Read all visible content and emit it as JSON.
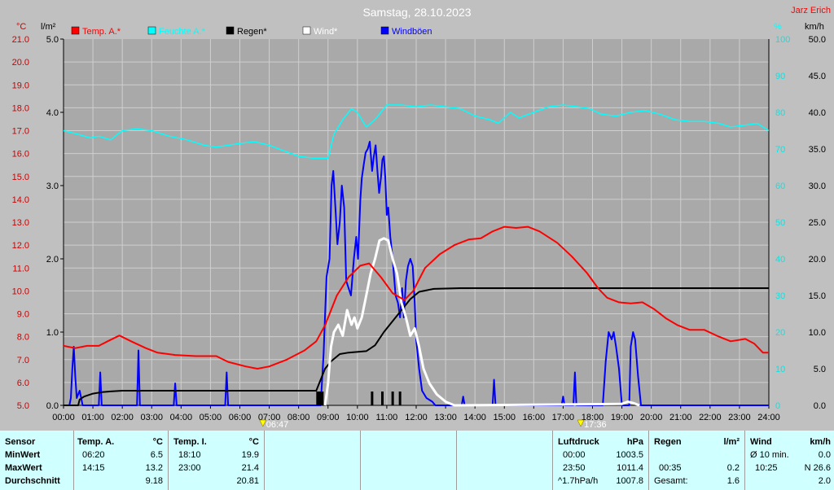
{
  "chart_data": {
    "type": "line",
    "title": "Samstag, 28.10.2023",
    "author": "Jarz Erich",
    "x_ticks": [
      "00:00",
      "01:00",
      "02:00",
      "03:00",
      "04:00",
      "05:00",
      "06:00",
      "07:00",
      "08:00",
      "09:00",
      "10:00",
      "11:00",
      "12:00",
      "13:00",
      "14:00",
      "15:00",
      "16:00",
      "17:00",
      "18:00",
      "19:00",
      "20:00",
      "21:00",
      "22:00",
      "23:00",
      "24:00"
    ],
    "axes": {
      "temp": {
        "unit": "°C",
        "range": [
          5.0,
          21.0
        ],
        "ticks": [
          "21.0",
          "20.0",
          "19.0",
          "18.0",
          "17.0",
          "16.0",
          "15.0",
          "14.0",
          "13.0",
          "12.0",
          "11.0",
          "10.0",
          "9.0",
          "8.0",
          "7.0",
          "6.0",
          "5.0"
        ]
      },
      "rain": {
        "unit": "l/m²",
        "range": [
          0.0,
          5.0
        ],
        "ticks": [
          "5.0",
          "4.0",
          "3.0",
          "2.0",
          "1.0",
          "0.0"
        ]
      },
      "hum": {
        "unit": "%",
        "range": [
          0,
          100
        ],
        "ticks": [
          "100",
          "90",
          "80",
          "70",
          "60",
          "50",
          "40",
          "30",
          "20",
          "10",
          "0"
        ]
      },
      "wind": {
        "unit": "km/h",
        "range": [
          0.0,
          50.0
        ],
        "ticks": [
          "50.0",
          "45.0",
          "40.0",
          "35.0",
          "30.0",
          "25.0",
          "20.0",
          "15.0",
          "10.0",
          "5.0",
          "0.0"
        ]
      }
    },
    "sunrise": "06:47",
    "sunset": "17:36",
    "legend": [
      {
        "name": "Temp. A.*",
        "color": "#ff0000"
      },
      {
        "name": "Feuchte A.*",
        "color": "#00ffff"
      },
      {
        "name": "Regen*",
        "color": "#000000"
      },
      {
        "name": "Wind*",
        "color": "#ffffff"
      },
      {
        "name": "Windböen",
        "color": "#0000ff"
      }
    ],
    "series": [
      {
        "name": "Temp. A.*",
        "axis": "temp",
        "color": "#ff0000",
        "points": [
          [
            0,
            7.6
          ],
          [
            0.4,
            7.5
          ],
          [
            0.8,
            7.6
          ],
          [
            1.2,
            7.6
          ],
          [
            1.5,
            7.8
          ],
          [
            1.9,
            8.05
          ],
          [
            2.3,
            7.8
          ],
          [
            2.8,
            7.5
          ],
          [
            3.2,
            7.3
          ],
          [
            3.8,
            7.2
          ],
          [
            4.5,
            7.15
          ],
          [
            5.2,
            7.15
          ],
          [
            5.6,
            6.9
          ],
          [
            6.2,
            6.7
          ],
          [
            6.6,
            6.6
          ],
          [
            7.0,
            6.7
          ],
          [
            7.6,
            7.0
          ],
          [
            8.2,
            7.4
          ],
          [
            8.6,
            7.8
          ],
          [
            8.9,
            8.5
          ],
          [
            9.3,
            9.8
          ],
          [
            9.7,
            10.6
          ],
          [
            10.1,
            11.1
          ],
          [
            10.4,
            11.2
          ],
          [
            10.8,
            10.6
          ],
          [
            11.2,
            9.9
          ],
          [
            11.6,
            9.6
          ],
          [
            11.9,
            10.0
          ],
          [
            12.3,
            11.0
          ],
          [
            12.8,
            11.6
          ],
          [
            13.3,
            12.0
          ],
          [
            13.8,
            12.25
          ],
          [
            14.2,
            12.3
          ],
          [
            14.6,
            12.6
          ],
          [
            15.0,
            12.8
          ],
          [
            15.4,
            12.75
          ],
          [
            15.8,
            12.8
          ],
          [
            16.2,
            12.6
          ],
          [
            16.8,
            12.1
          ],
          [
            17.3,
            11.5
          ],
          [
            17.8,
            10.8
          ],
          [
            18.2,
            10.1
          ],
          [
            18.5,
            9.7
          ],
          [
            18.9,
            9.5
          ],
          [
            19.3,
            9.45
          ],
          [
            19.7,
            9.5
          ],
          [
            20.1,
            9.2
          ],
          [
            20.5,
            8.8
          ],
          [
            20.9,
            8.5
          ],
          [
            21.3,
            8.3
          ],
          [
            21.8,
            8.3
          ],
          [
            22.3,
            8.0
          ],
          [
            22.7,
            7.8
          ],
          [
            23.2,
            7.9
          ],
          [
            23.5,
            7.7
          ],
          [
            23.8,
            7.3
          ],
          [
            24.0,
            7.3
          ]
        ]
      },
      {
        "name": "Feuchte A.*",
        "axis": "hum",
        "color": "#00ffff",
        "points": [
          [
            0,
            75
          ],
          [
            0.5,
            74
          ],
          [
            0.9,
            73
          ],
          [
            1.2,
            73.5
          ],
          [
            1.6,
            72.5
          ],
          [
            2.0,
            75
          ],
          [
            2.5,
            75.5
          ],
          [
            3.0,
            75
          ],
          [
            3.6,
            73.5
          ],
          [
            4.2,
            72.5
          ],
          [
            4.8,
            71
          ],
          [
            5.2,
            70.5
          ],
          [
            5.6,
            71
          ],
          [
            6.0,
            71.5
          ],
          [
            6.5,
            72
          ],
          [
            7.0,
            71
          ],
          [
            7.5,
            69.5
          ],
          [
            8.0,
            68
          ],
          [
            8.5,
            67.5
          ],
          [
            9.0,
            67.5
          ],
          [
            9.2,
            74
          ],
          [
            9.5,
            78
          ],
          [
            9.8,
            81
          ],
          [
            10.0,
            80
          ],
          [
            10.3,
            76
          ],
          [
            10.6,
            78
          ],
          [
            11.0,
            82
          ],
          [
            11.5,
            82
          ],
          [
            12.0,
            81.5
          ],
          [
            12.5,
            82
          ],
          [
            13.0,
            81.5
          ],
          [
            13.5,
            81
          ],
          [
            14.0,
            79
          ],
          [
            14.5,
            78
          ],
          [
            14.8,
            77
          ],
          [
            15.2,
            80
          ],
          [
            15.5,
            78.5
          ],
          [
            16.0,
            80
          ],
          [
            16.5,
            81.5
          ],
          [
            17.0,
            82
          ],
          [
            17.5,
            81.5
          ],
          [
            17.9,
            81
          ],
          [
            18.3,
            79.5
          ],
          [
            18.8,
            79
          ],
          [
            19.3,
            80
          ],
          [
            19.8,
            80.5
          ],
          [
            20.3,
            79.5
          ],
          [
            20.8,
            78
          ],
          [
            21.3,
            77.5
          ],
          [
            21.8,
            77.5
          ],
          [
            22.3,
            77
          ],
          [
            22.7,
            76
          ],
          [
            23.2,
            76.5
          ],
          [
            23.6,
            77
          ],
          [
            24.0,
            75
          ]
        ]
      },
      {
        "name": "Regen*",
        "axis": "rain",
        "color": "#000000",
        "points": [
          [
            0,
            0
          ],
          [
            0.5,
            0
          ],
          [
            0.55,
            0.08
          ],
          [
            0.7,
            0.12
          ],
          [
            1.0,
            0.16
          ],
          [
            1.3,
            0.18
          ],
          [
            1.6,
            0.19
          ],
          [
            2.0,
            0.2
          ],
          [
            8.6,
            0.2
          ],
          [
            8.7,
            0.3
          ],
          [
            8.9,
            0.5
          ],
          [
            9.1,
            0.6
          ],
          [
            9.4,
            0.7
          ],
          [
            9.7,
            0.72
          ],
          [
            10.3,
            0.74
          ],
          [
            10.6,
            0.82
          ],
          [
            10.9,
            1.0
          ],
          [
            11.2,
            1.15
          ],
          [
            11.5,
            1.3
          ],
          [
            11.8,
            1.45
          ],
          [
            12.1,
            1.55
          ],
          [
            12.6,
            1.59
          ],
          [
            13.5,
            1.6
          ],
          [
            24.0,
            1.6
          ]
        ]
      },
      {
        "name": "Wind*",
        "axis": "wind",
        "color": "#ffffff",
        "points": [
          [
            8.9,
            0
          ],
          [
            9.0,
            3
          ],
          [
            9.1,
            8
          ],
          [
            9.2,
            10
          ],
          [
            9.35,
            11
          ],
          [
            9.5,
            9.5
          ],
          [
            9.65,
            13
          ],
          [
            9.8,
            11
          ],
          [
            9.9,
            12
          ],
          [
            10.0,
            10.5
          ],
          [
            10.15,
            12
          ],
          [
            10.3,
            15
          ],
          [
            10.45,
            18
          ],
          [
            10.6,
            20
          ],
          [
            10.75,
            22.5
          ],
          [
            10.9,
            22.8
          ],
          [
            11.05,
            22.5
          ],
          [
            11.2,
            20
          ],
          [
            11.35,
            18
          ],
          [
            11.5,
            14
          ],
          [
            11.65,
            12
          ],
          [
            11.8,
            9.5
          ],
          [
            11.95,
            10.5
          ],
          [
            12.1,
            8
          ],
          [
            12.25,
            5
          ],
          [
            12.45,
            3
          ],
          [
            12.7,
            1.5
          ],
          [
            13.0,
            0.5
          ],
          [
            13.3,
            0
          ],
          [
            19.0,
            0.2
          ],
          [
            19.2,
            0.5
          ],
          [
            19.4,
            0.3
          ],
          [
            19.6,
            0
          ]
        ]
      },
      {
        "name": "Windböen",
        "axis": "wind",
        "color": "#0000ff",
        "points": [
          [
            0,
            0
          ],
          [
            0.2,
            0
          ],
          [
            0.25,
            1
          ],
          [
            0.3,
            5
          ],
          [
            0.35,
            8
          ],
          [
            0.4,
            4
          ],
          [
            0.45,
            1
          ],
          [
            0.55,
            2
          ],
          [
            0.65,
            0
          ],
          [
            1.2,
            0
          ],
          [
            1.25,
            4.5
          ],
          [
            1.3,
            0
          ],
          [
            2.5,
            0
          ],
          [
            2.55,
            7.5
          ],
          [
            2.6,
            0
          ],
          [
            3.75,
            0
          ],
          [
            3.8,
            3
          ],
          [
            3.85,
            0
          ],
          [
            5.5,
            0
          ],
          [
            5.55,
            4.5
          ],
          [
            5.6,
            0
          ],
          [
            8.75,
            0
          ],
          [
            8.85,
            7
          ],
          [
            8.95,
            17.5
          ],
          [
            9.05,
            20
          ],
          [
            9.12,
            30
          ],
          [
            9.18,
            32
          ],
          [
            9.25,
            27
          ],
          [
            9.32,
            22
          ],
          [
            9.4,
            25
          ],
          [
            9.47,
            30
          ],
          [
            9.55,
            27
          ],
          [
            9.62,
            17
          ],
          [
            9.7,
            16
          ],
          [
            9.78,
            15
          ],
          [
            9.88,
            20
          ],
          [
            9.96,
            23
          ],
          [
            10.02,
            20
          ],
          [
            10.1,
            28
          ],
          [
            10.15,
            31
          ],
          [
            10.22,
            33
          ],
          [
            10.28,
            34.5
          ],
          [
            10.35,
            35
          ],
          [
            10.42,
            36
          ],
          [
            10.5,
            32
          ],
          [
            10.56,
            34
          ],
          [
            10.62,
            35.5
          ],
          [
            10.68,
            32
          ],
          [
            10.74,
            29
          ],
          [
            10.8,
            31
          ],
          [
            10.85,
            33.5
          ],
          [
            10.9,
            34
          ],
          [
            10.95,
            31
          ],
          [
            11.0,
            26
          ],
          [
            11.05,
            27
          ],
          [
            11.12,
            23
          ],
          [
            11.2,
            20
          ],
          [
            11.3,
            15
          ],
          [
            11.38,
            14
          ],
          [
            11.45,
            12
          ],
          [
            11.52,
            16
          ],
          [
            11.58,
            12
          ],
          [
            11.65,
            17
          ],
          [
            11.72,
            19
          ],
          [
            11.8,
            20
          ],
          [
            11.88,
            19
          ],
          [
            11.95,
            14
          ],
          [
            12.0,
            9
          ],
          [
            12.1,
            5
          ],
          [
            12.2,
            2
          ],
          [
            12.35,
            1
          ],
          [
            12.55,
            0.5
          ],
          [
            12.65,
            0
          ],
          [
            13.55,
            0
          ],
          [
            13.6,
            1.2
          ],
          [
            13.65,
            0
          ],
          [
            14.6,
            0
          ],
          [
            14.65,
            3.5
          ],
          [
            14.7,
            0
          ],
          [
            16.95,
            0
          ],
          [
            17.0,
            1.2
          ],
          [
            17.05,
            0
          ],
          [
            17.35,
            0
          ],
          [
            17.4,
            4.5
          ],
          [
            17.45,
            0
          ],
          [
            18.35,
            0
          ],
          [
            18.45,
            6
          ],
          [
            18.55,
            10
          ],
          [
            18.65,
            9
          ],
          [
            18.72,
            10
          ],
          [
            18.8,
            8
          ],
          [
            18.9,
            5
          ],
          [
            19.0,
            0
          ],
          [
            19.25,
            0
          ],
          [
            19.3,
            8
          ],
          [
            19.38,
            10
          ],
          [
            19.45,
            9
          ],
          [
            19.55,
            4
          ],
          [
            19.65,
            0
          ],
          [
            24,
            0
          ]
        ]
      }
    ],
    "rain_ticks_hours": [
      10.5,
      10.85,
      11.2,
      11.45
    ],
    "rain_block_hours": [
      8.6,
      8.85
    ]
  },
  "table": {
    "sensor": {
      "h": "Sensor",
      "min": "MinWert",
      "max": "MaxWert",
      "avg": "Durchschnitt"
    },
    "temp_a": {
      "h": "Temp. A.",
      "unit": "°C",
      "min_time": "06:20",
      "min_val": "6.5",
      "max_time": "14:15",
      "max_val": "13.2",
      "avg": "9.18"
    },
    "temp_i": {
      "h": "Temp. I.",
      "unit": "°C",
      "min_time": "18:10",
      "min_val": "19.9",
      "max_time": "23:00",
      "max_val": "21.4",
      "avg": "20.81"
    },
    "pressure": {
      "h": "Luftdruck",
      "unit": "hPa",
      "min_time": "00:00",
      "min_val": "1003.5",
      "max_time": "23:50",
      "max_val": "1011.4",
      "trend": "^1.7hPa/h",
      "avg": "1007.8"
    },
    "rain": {
      "h": "Regen",
      "unit": "l/m²",
      "max_time": "00:35",
      "max_val": "0.2",
      "total_label": "Gesamt:",
      "total": "1.6"
    },
    "wind": {
      "h": "Wind",
      "unit": "km/h",
      "min_label": "Ø 10 min.",
      "min_val": "0.0",
      "max_time": "10:25",
      "max_val": "N 26.6",
      "avg": "2.0"
    }
  }
}
